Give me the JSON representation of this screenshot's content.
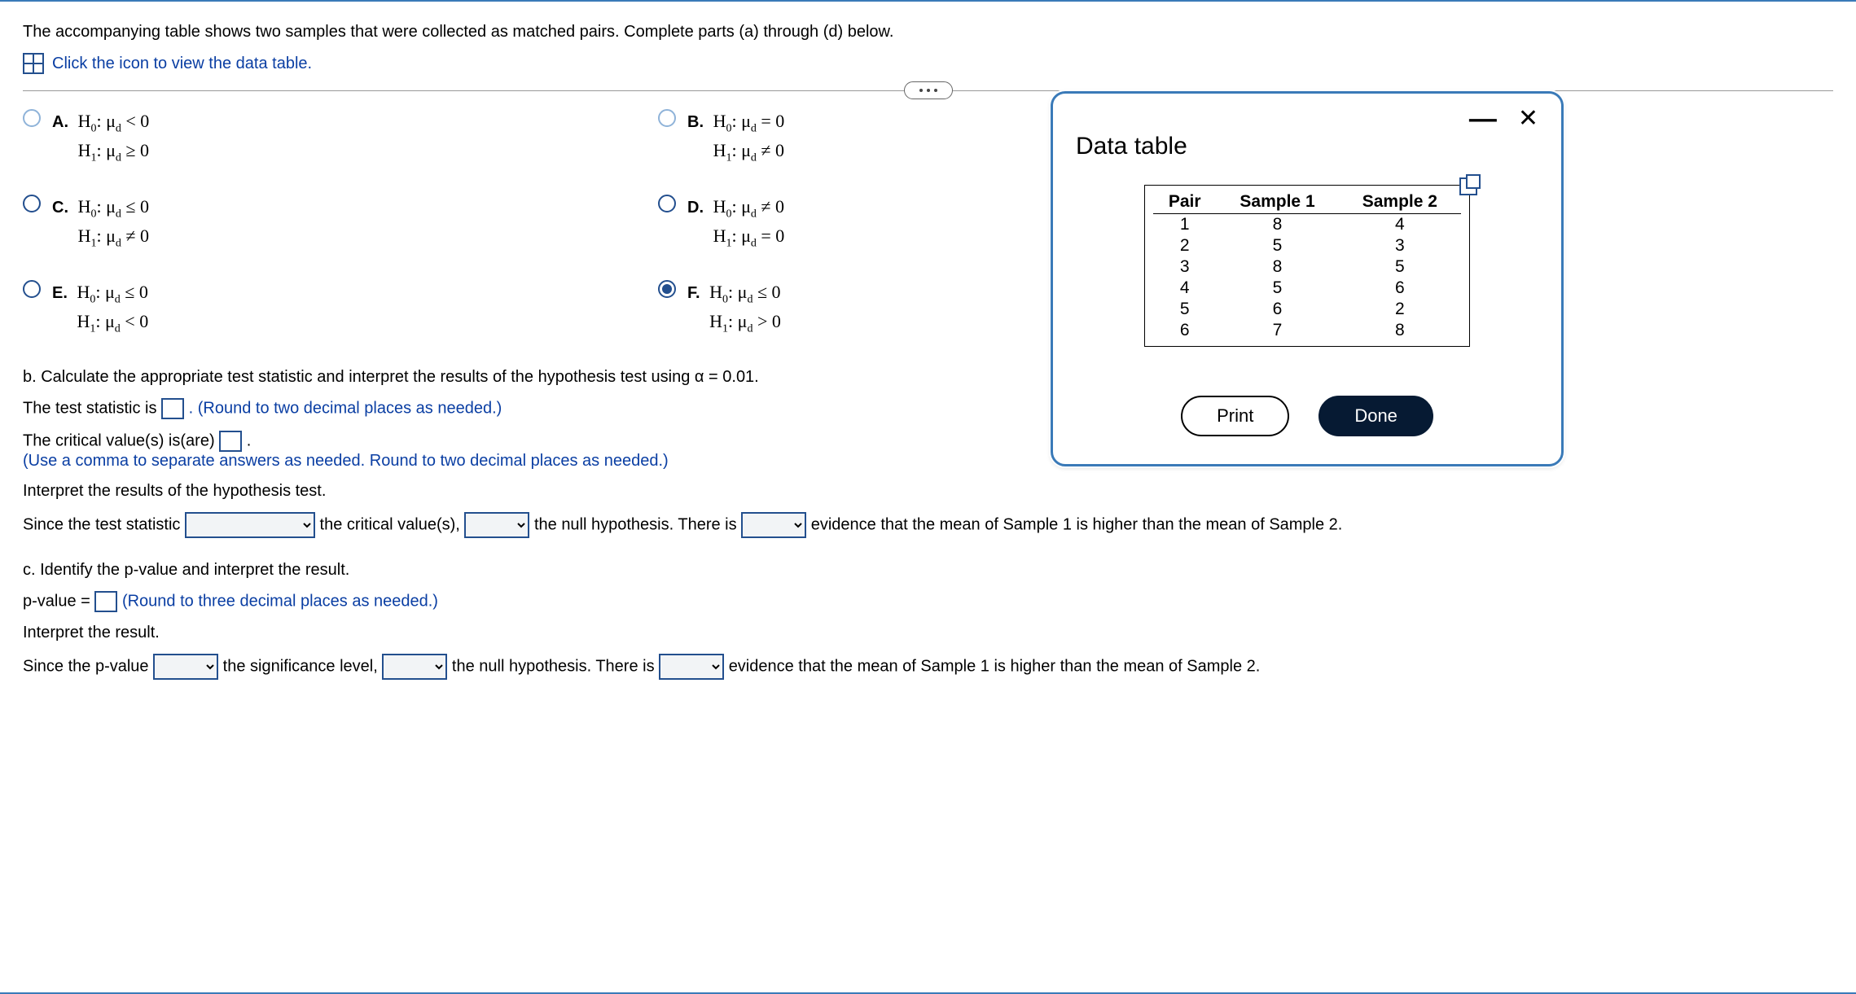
{
  "intro": "The accompanying table shows two samples that were collected as matched pairs. Complete parts (a) through (d) below.",
  "icon_hint": "Click the icon to view the data table.",
  "options": {
    "A": {
      "h0": "H₀: μ_d < 0",
      "h1": "H₁: μ_d ≥ 0"
    },
    "B": {
      "h0": "H₀: μ_d = 0",
      "h1": "H₁: μ_d ≠ 0"
    },
    "C": {
      "h0": "H₀: μ_d ≤ 0",
      "h1": "H₁: μ_d ≠ 0"
    },
    "D": {
      "h0": "H₀: μ_d ≠ 0",
      "h1": "H₁: μ_d = 0"
    },
    "E": {
      "h0": "H₀: μ_d ≤ 0",
      "h1": "H₁: μ_d < 0"
    },
    "F": {
      "h0": "H₀: μ_d ≤ 0",
      "h1": "H₁: μ_d > 0"
    }
  },
  "selected_option": "F",
  "part_b": {
    "prompt": "b. Calculate the appropriate test statistic and interpret the results of the hypothesis test using α = 0.01.",
    "stat_before": "The test statistic is ",
    "stat_after": ". (Round to two decimal places as needed.)",
    "crit_before": "The critical value(s) is(are) ",
    "crit_after": ".",
    "crit_hint": "(Use a comma to separate answers as needed. Round to two decimal places as needed.)",
    "interp_label": "Interpret the results of the hypothesis test.",
    "sent_a": "Since the test statistic ",
    "sent_b": " the critical value(s), ",
    "sent_c": " the null hypothesis. There is ",
    "sent_d": " evidence that the mean of Sample 1 is higher than the mean of Sample 2."
  },
  "part_c": {
    "prompt": "c. Identify the p-value and interpret the result.",
    "pval_before": "p-value = ",
    "pval_after": " (Round to three decimal places as needed.)",
    "interp_label": "Interpret the result.",
    "sent_a": "Since the p-value ",
    "sent_b": " the significance level, ",
    "sent_c": " the null hypothesis. There is ",
    "sent_d": " evidence that the mean of Sample 1 is higher than the mean of Sample 2."
  },
  "modal": {
    "title": "Data table",
    "headers": {
      "pair": "Pair",
      "s1": "Sample 1",
      "s2": "Sample 2"
    },
    "rows": [
      {
        "pair": "1",
        "s1": "8",
        "s2": "4"
      },
      {
        "pair": "2",
        "s1": "5",
        "s2": "3"
      },
      {
        "pair": "3",
        "s1": "8",
        "s2": "5"
      },
      {
        "pair": "4",
        "s1": "5",
        "s2": "6"
      },
      {
        "pair": "5",
        "s1": "6",
        "s2": "2"
      },
      {
        "pair": "6",
        "s1": "7",
        "s2": "8"
      }
    ],
    "print": "Print",
    "done": "Done"
  },
  "chart_data": {
    "type": "table",
    "title": "Data table",
    "columns": [
      "Pair",
      "Sample 1",
      "Sample 2"
    ],
    "rows": [
      [
        1,
        8,
        4
      ],
      [
        2,
        5,
        3
      ],
      [
        3,
        8,
        5
      ],
      [
        4,
        5,
        6
      ],
      [
        5,
        6,
        2
      ],
      [
        6,
        7,
        8
      ]
    ]
  }
}
